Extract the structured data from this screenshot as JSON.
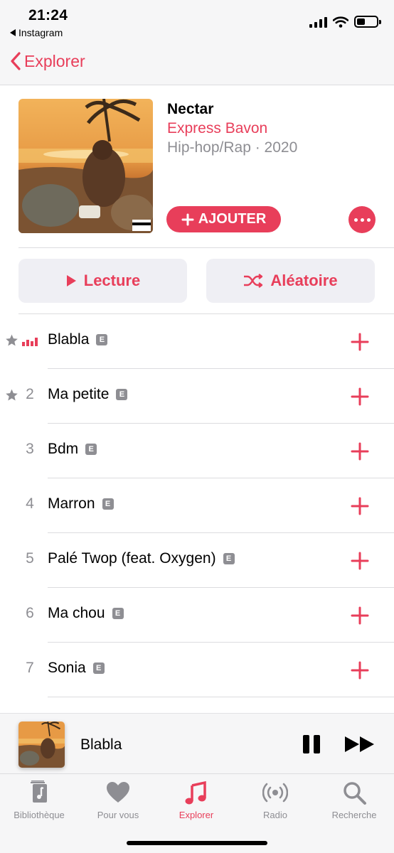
{
  "status_bar": {
    "time": "21:24",
    "back_app": "Instagram"
  },
  "nav": {
    "back_label": "Explorer"
  },
  "album": {
    "title": "Nectar",
    "artist": "Express Bavon",
    "meta": "Hip-hop/Rap · 2020",
    "add_label": "AJOUTER",
    "artwork_icon": "album-artwork"
  },
  "actions": {
    "play_label": "Lecture",
    "shuffle_label": "Aléatoire"
  },
  "tracks": [
    {
      "number": "",
      "title": "Blabla",
      "explicit": "E",
      "starred": true,
      "playing": true
    },
    {
      "number": "2",
      "title": "Ma petite",
      "explicit": "E",
      "starred": true,
      "playing": false
    },
    {
      "number": "3",
      "title": "Bdm",
      "explicit": "E",
      "starred": false,
      "playing": false
    },
    {
      "number": "4",
      "title": "Marron",
      "explicit": "E",
      "starred": false,
      "playing": false
    },
    {
      "number": "5",
      "title": "Palé Twop (feat. Oxygen)",
      "explicit": "E",
      "starred": false,
      "playing": false
    },
    {
      "number": "6",
      "title": "Ma chou",
      "explicit": "E",
      "starred": false,
      "playing": false
    },
    {
      "number": "7",
      "title": "Sonia",
      "explicit": "E",
      "starred": false,
      "playing": false
    }
  ],
  "mini_player": {
    "title": "Blabla"
  },
  "tabs": [
    {
      "label": "Bibliothèque",
      "icon": "library-icon",
      "active": false
    },
    {
      "label": "Pour vous",
      "icon": "heart-icon",
      "active": false
    },
    {
      "label": "Explorer",
      "icon": "music-note-icon",
      "active": true
    },
    {
      "label": "Radio",
      "icon": "radio-icon",
      "active": false
    },
    {
      "label": "Recherche",
      "icon": "search-icon",
      "active": false
    }
  ],
  "colors": {
    "accent": "#e83e5a",
    "secondary_text": "#8e8e93",
    "bar_bg": "#f6f6f7",
    "pill_bg": "#efeff4"
  }
}
